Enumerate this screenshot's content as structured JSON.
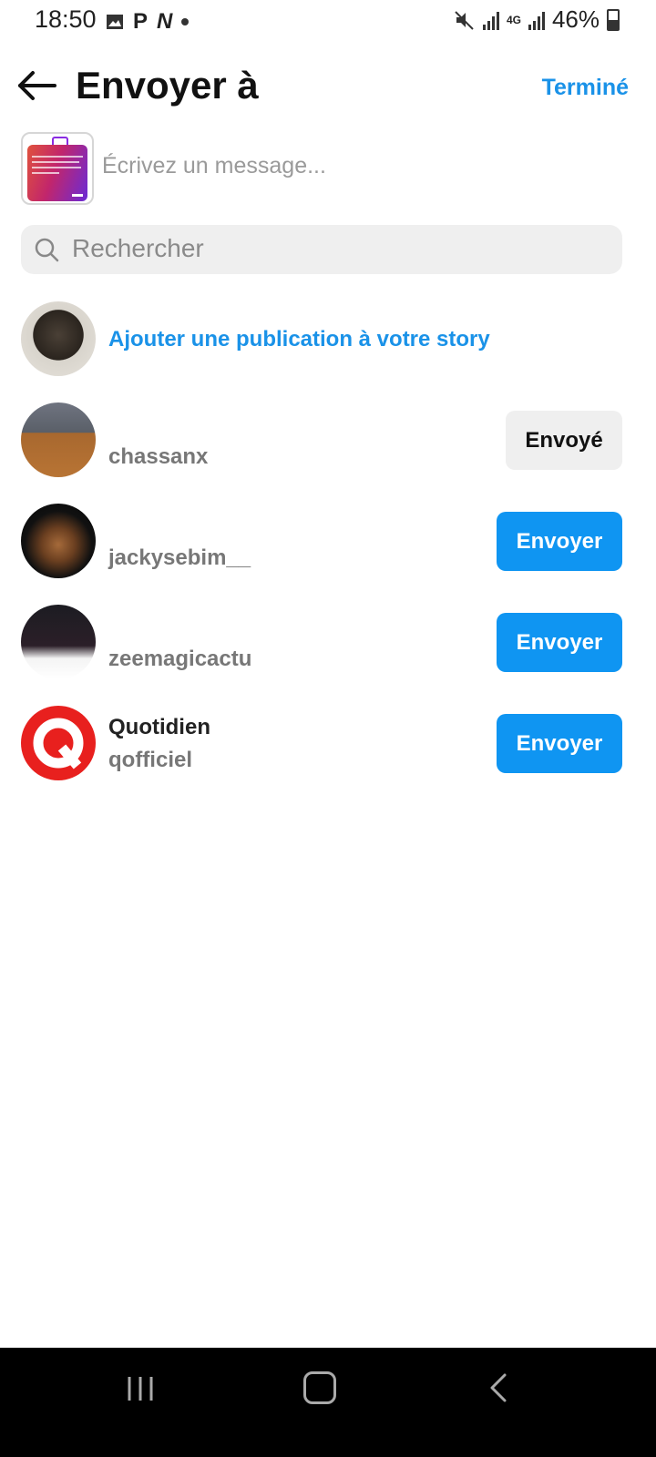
{
  "status_bar": {
    "time": "18:50",
    "battery": "46%",
    "network": "4G",
    "left_icons": [
      "image-icon",
      "pinterest-icon",
      "n-app-icon",
      "dot-icon"
    ],
    "right_icons": [
      "mute-icon",
      "signal-icon",
      "4g-icon",
      "signal-icon",
      "battery-icon"
    ],
    "battery_level": 0.46
  },
  "header": {
    "title": "Envoyer à",
    "done_label": "Terminé"
  },
  "message": {
    "placeholder": "Écrivez un message..."
  },
  "search": {
    "placeholder": "Rechercher"
  },
  "story": {
    "label": "Ajouter une publication à votre story"
  },
  "contacts": [
    {
      "username": "chassanx",
      "button": "Envoyé"
    },
    {
      "username": "jackysebim__",
      "button": "Envoyer"
    },
    {
      "username": "zeemagicactu",
      "button": "Envoyer"
    },
    {
      "display_name": "Quotidien",
      "username": "qofficiel",
      "button": "Envoyer"
    }
  ],
  "colors": {
    "accent": "#1a92e8",
    "send_button": "#0f95f2",
    "sent_button": "#efefef",
    "quotidien_red": "#e8201e"
  }
}
